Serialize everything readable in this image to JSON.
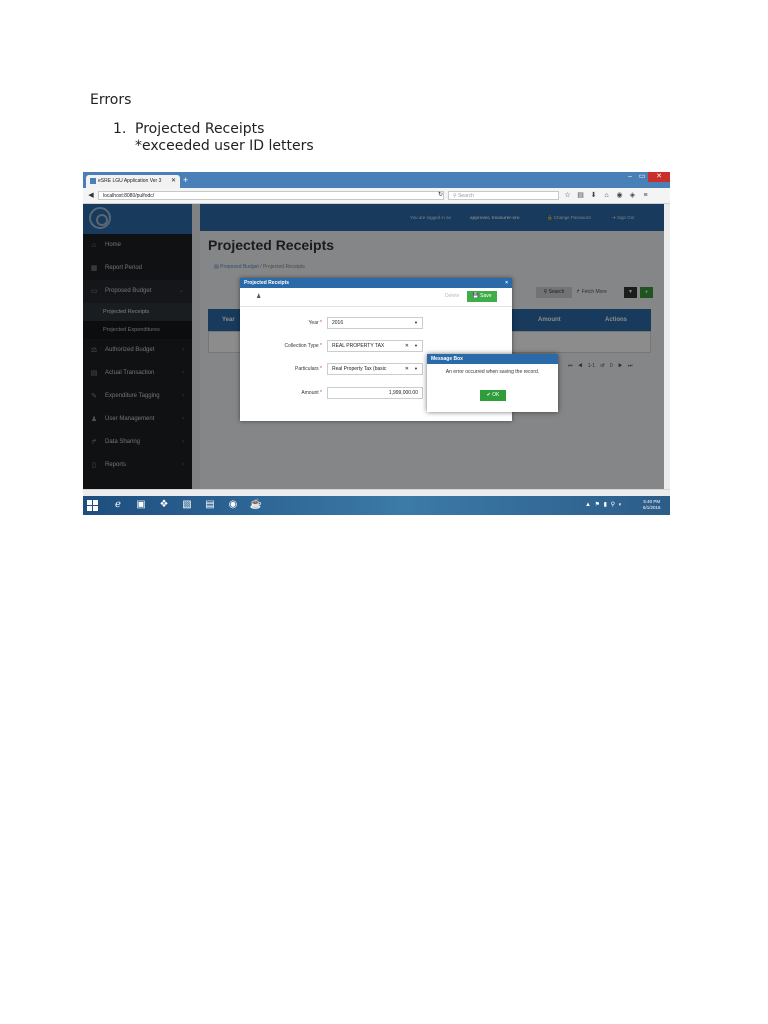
{
  "doc": {
    "heading": "Errors",
    "item_number": "1.",
    "item_title": "Projected Receipts",
    "item_note": "*exceeded user ID letters"
  },
  "browser": {
    "tab_title": "eSRE LGU Application Ver 3",
    "tab_close": "✕",
    "new_tab": "+",
    "url": "localhost:8080/pulfodc/",
    "search_placeholder": "Search",
    "win_min": "–",
    "win_max": "▭",
    "win_close": "✕"
  },
  "sidebar": {
    "items": [
      {
        "label": "Home",
        "icon": "home-icon",
        "glyph": "⌂"
      },
      {
        "label": "Report Period",
        "icon": "calendar-icon",
        "glyph": "▦"
      },
      {
        "label": "Proposed Budget",
        "icon": "money-icon",
        "glyph": "▭",
        "chevron": "⌄"
      },
      {
        "label": "Authorized Budget",
        "icon": "gavel-icon",
        "glyph": "⚖",
        "chevron": "‹"
      },
      {
        "label": "Actual Transaction",
        "icon": "chart-icon",
        "glyph": "▤",
        "chevron": "‹"
      },
      {
        "label": "Expenditure Tagging",
        "icon": "tag-icon",
        "glyph": "✎",
        "chevron": "‹"
      },
      {
        "label": "User Management",
        "icon": "user-icon",
        "glyph": "♟",
        "chevron": "‹"
      },
      {
        "label": "Data Sharing",
        "icon": "share-icon",
        "glyph": "↱",
        "chevron": "‹"
      },
      {
        "label": "Reports",
        "icon": "file-icon",
        "glyph": "▯",
        "chevron": "‹"
      }
    ],
    "sub_items": [
      "Projected Receipts",
      "Projected Expenditures"
    ]
  },
  "topbar": {
    "logged_in": "You are logged in as",
    "username": "approver, treasurer-sro",
    "change_password": "Change Password",
    "sign_out": "Sign Out"
  },
  "page": {
    "title": "Projected Receipts",
    "breadcrumb_parent": "Proposed Budget",
    "breadcrumb_current": "Projected Receipts",
    "search_btn": "Search",
    "fetch_btn": "Fetch More",
    "filter_glyph": "▼",
    "add_glyph": "+",
    "col_year": "Year",
    "col_amount": "Amount",
    "col_actions": "Actions",
    "pager": "⏮ ◀ 1-1 of 0 ▶ ⏭"
  },
  "modal": {
    "title": "Projected Receipts",
    "close": "×",
    "delete": "Delete",
    "save": "Save",
    "year_label": "Year",
    "year_value": "2016",
    "collection_label": "Collection Type",
    "collection_value": "REAL PROPERTY TAX",
    "particulars_label": "Particulars",
    "particulars_value": "Real Property Tax (basic",
    "amount_label": "Amount",
    "amount_value": "1,999,000.00"
  },
  "message_box": {
    "title": "Message Box",
    "text": "An error occurred when saving the record.",
    "ok": "OK"
  },
  "taskbar": {
    "tray": "▲ ⚑ ▮ ⚲ ◐",
    "time": "5:40 PM",
    "date": "6/1/2016"
  }
}
